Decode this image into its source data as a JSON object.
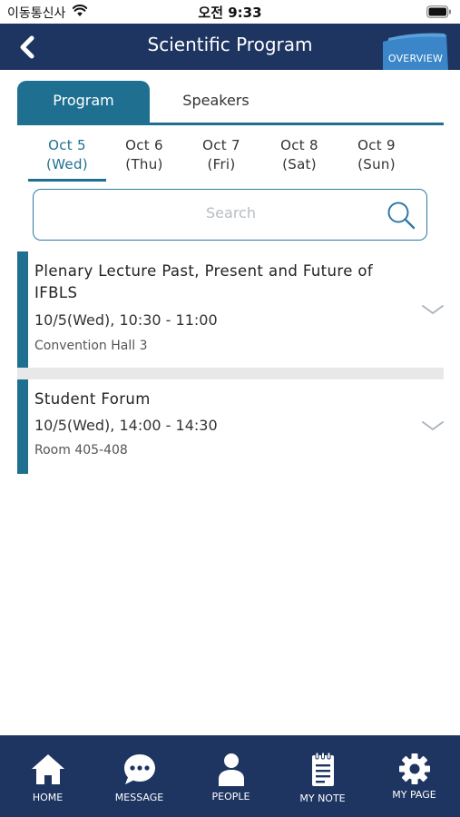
{
  "status_bar": {
    "carrier": "이동통신사",
    "time": "오전 9:33"
  },
  "header": {
    "title": "Scientific Program",
    "overview_label": "OVERVIEW"
  },
  "tabs": [
    {
      "label": "Program",
      "active": true
    },
    {
      "label": "Speakers",
      "active": false
    }
  ],
  "dates": [
    {
      "day": "Oct 5",
      "weekday": "(Wed)",
      "active": true
    },
    {
      "day": "Oct 6",
      "weekday": "(Thu)",
      "active": false
    },
    {
      "day": "Oct 7",
      "weekday": "(Fri)",
      "active": false
    },
    {
      "day": "Oct 8",
      "weekday": "(Sat)",
      "active": false
    },
    {
      "day": "Oct 9",
      "weekday": "(Sun)",
      "active": false
    }
  ],
  "search": {
    "placeholder": "Search"
  },
  "sessions": [
    {
      "title": "Plenary Lecture Past, Present and Future of IFBLS",
      "time": "10/5(Wed), 10:30 - 11:00",
      "room": "Convention Hall 3"
    },
    {
      "title": "Student Forum",
      "time": "10/5(Wed), 14:00 - 14:30",
      "room": "Room 405-408"
    }
  ],
  "bottom_nav": [
    {
      "label": "HOME",
      "icon": "home-icon"
    },
    {
      "label": "MESSAGE",
      "icon": "message-icon"
    },
    {
      "label": "PEOPLE",
      "icon": "person-icon"
    },
    {
      "label": "MY NOTE",
      "icon": "note-icon"
    },
    {
      "label": "MY PAGE",
      "icon": "gear-icon"
    }
  ],
  "colors": {
    "navy": "#1e3561",
    "teal": "#1f7090",
    "overview_blue": "#3a86c8"
  }
}
